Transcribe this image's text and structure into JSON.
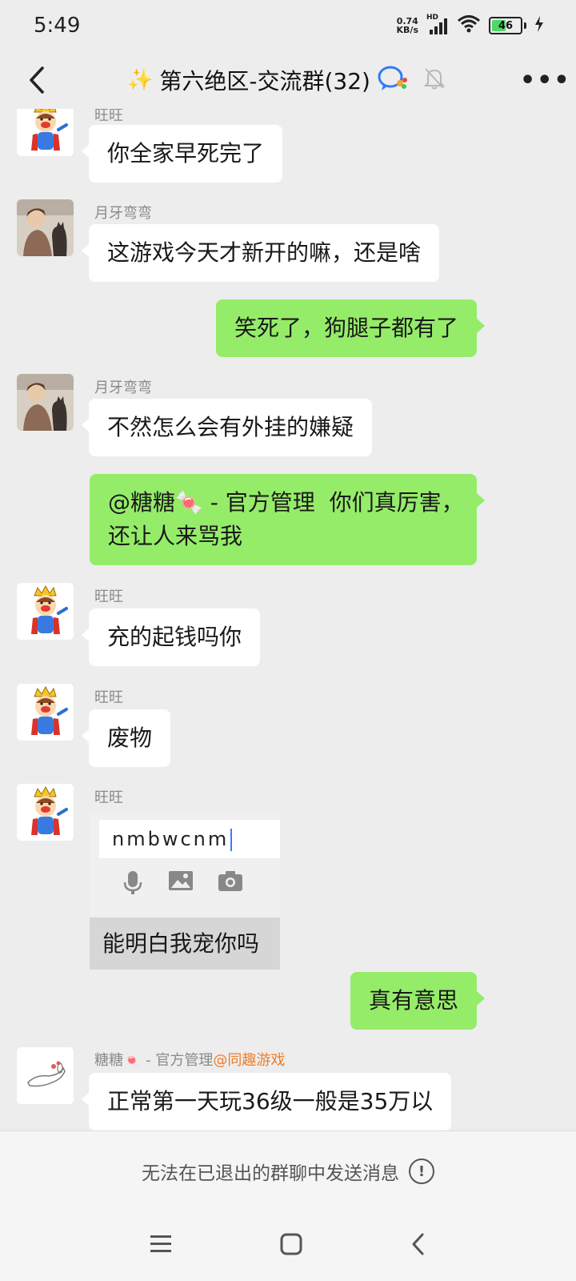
{
  "status_bar": {
    "time": "5:49",
    "net_speed_value": "0.74",
    "net_speed_unit": "KB/s",
    "network_type": "HD",
    "battery": "46",
    "icons": [
      "signal-icon",
      "wifi-icon",
      "battery-icon",
      "charging-icon"
    ]
  },
  "header": {
    "title": "第六绝区-交流群(32)",
    "title_prefix_icon": "sparkles-icon",
    "icons": [
      "back-icon",
      "chat-badge-icon",
      "mute-bell-icon",
      "more-icon"
    ]
  },
  "messages": [
    {
      "side": "left",
      "sender": "旺旺",
      "avatar": "king-cartoon-avatar",
      "text": "你全家早死完了"
    },
    {
      "side": "left",
      "sender": "月牙弯弯",
      "avatar": "boy-with-cat-avatar",
      "text": "这游戏今天才新开的嘛，还是啥"
    },
    {
      "side": "right",
      "text": "笑死了，狗腿子都有了"
    },
    {
      "side": "left",
      "sender": "月牙弯弯",
      "avatar": "boy-with-cat-avatar",
      "text": "不然怎么会有外挂的嫌疑"
    },
    {
      "side": "right",
      "text_line1": "@糖糖🍬 - 官方管理  你们真厉害，",
      "text_line2": "还让人来骂我"
    },
    {
      "side": "left",
      "sender": "旺旺",
      "avatar": "king-cartoon-avatar",
      "text": "充的起钱吗你"
    },
    {
      "side": "left",
      "sender": "旺旺",
      "avatar": "king-cartoon-avatar",
      "text": "废物"
    },
    {
      "side": "left",
      "sender": "旺旺",
      "avatar": "king-cartoon-avatar",
      "image_input_text": "nmbwcnm",
      "image_caption": "能明白我宠你吗"
    },
    {
      "side": "right",
      "text": "真有意思"
    },
    {
      "side": "left",
      "sender": "糖糖🍬 - 官方管理",
      "sender_tag": "@同趣游戏",
      "avatar": "rabbit-sketch-avatar",
      "text": "正常第一天玩36级一般是35万以"
    }
  ],
  "footer": {
    "notice": "无法在已退出的群聊中发送消息",
    "icon": "info-icon"
  },
  "nav_bar": {
    "icons": [
      "menu-icon",
      "home-icon",
      "back-nav-icon"
    ]
  },
  "colors": {
    "background": "#ededed",
    "bubble_self": "#95ec69",
    "bubble_other": "#ffffff",
    "sender_tag": "#f07c2a"
  }
}
